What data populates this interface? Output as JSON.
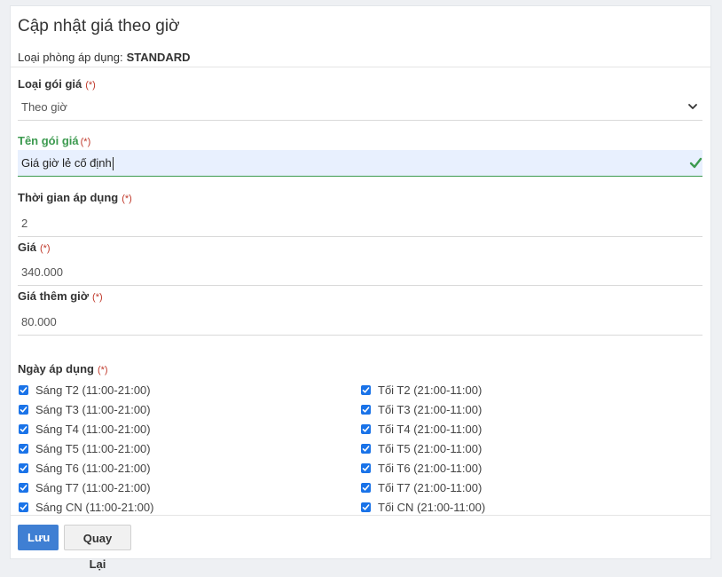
{
  "header": {
    "title": "Cập nhật giá theo giờ",
    "room_type_label": "Loại phòng áp dụng:",
    "room_type_value": "STANDARD"
  },
  "required_mark": "(*)",
  "fields": {
    "package_type": {
      "label": "Loại gói giá",
      "value": "Theo giờ"
    },
    "package_name": {
      "label": "Tên gói giá",
      "value": "Giá giờ lẻ cố định"
    },
    "duration": {
      "label": "Thời gian áp dụng",
      "value": "2"
    },
    "price": {
      "label": "Giá",
      "value": "340.000"
    },
    "extra_hour_price": {
      "label": "Giá thêm giờ",
      "value": "80.000"
    }
  },
  "days": {
    "label": "Ngày áp dụng",
    "morning": [
      "Sáng T2 (11:00-21:00)",
      "Sáng T3 (11:00-21:00)",
      "Sáng T4 (11:00-21:00)",
      "Sáng T5 (11:00-21:00)",
      "Sáng T6 (11:00-21:00)",
      "Sáng T7 (11:00-21:00)",
      "Sáng CN (11:00-21:00)"
    ],
    "evening": [
      "Tối T2 (21:00-11:00)",
      "Tối T3 (21:00-11:00)",
      "Tối T4 (21:00-11:00)",
      "Tối T5 (21:00-11:00)",
      "Tối T6 (21:00-11:00)",
      "Tối T7 (21:00-11:00)",
      "Tối CN (21:00-11:00)"
    ]
  },
  "buttons": {
    "save": "Lưu",
    "back": "Quay Lại"
  },
  "colors": {
    "primary": "#3f7fd3",
    "checkbox": "#1a73e8",
    "valid": "#3c9a4f",
    "required": "#c0392b"
  }
}
